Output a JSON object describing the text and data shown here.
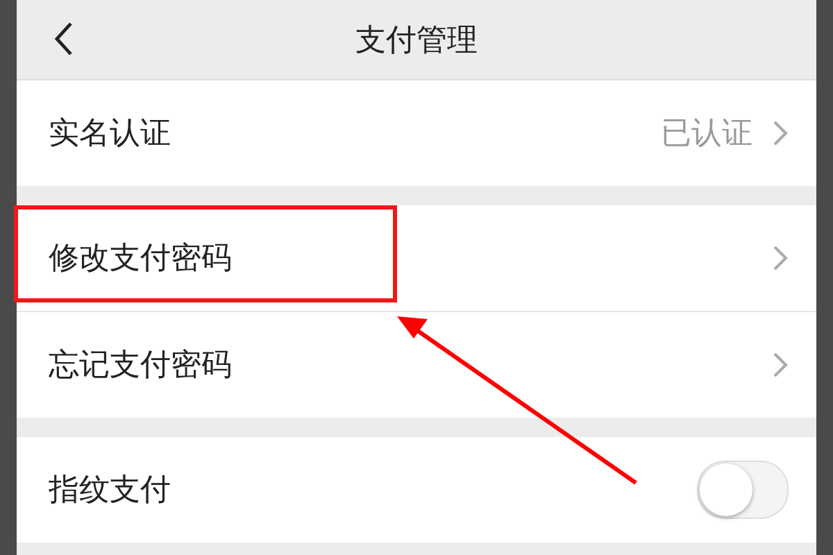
{
  "header": {
    "title": "支付管理"
  },
  "groups": [
    {
      "rows": [
        {
          "kind": "link",
          "label": "实名认证",
          "value": "已认证",
          "highlighted": false
        }
      ]
    },
    {
      "rows": [
        {
          "kind": "link",
          "label": "修改支付密码",
          "highlighted": true
        },
        {
          "kind": "link",
          "label": "忘记支付密码",
          "highlighted": false
        }
      ]
    },
    {
      "rows": [
        {
          "kind": "toggle",
          "label": "指纹支付",
          "on": false,
          "highlighted": false
        }
      ]
    }
  ]
}
